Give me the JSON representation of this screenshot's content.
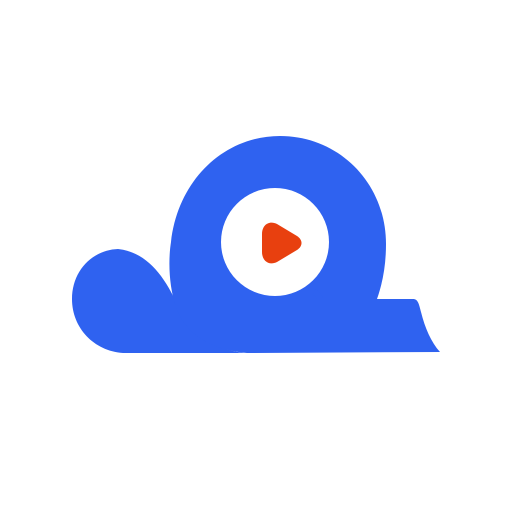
{
  "icon": {
    "name": "cloud-video-play-icon",
    "colors": {
      "background": "#ffffff",
      "primary": "#2f62f0",
      "inner": "#ffffff",
      "play": "#e8400f"
    }
  }
}
